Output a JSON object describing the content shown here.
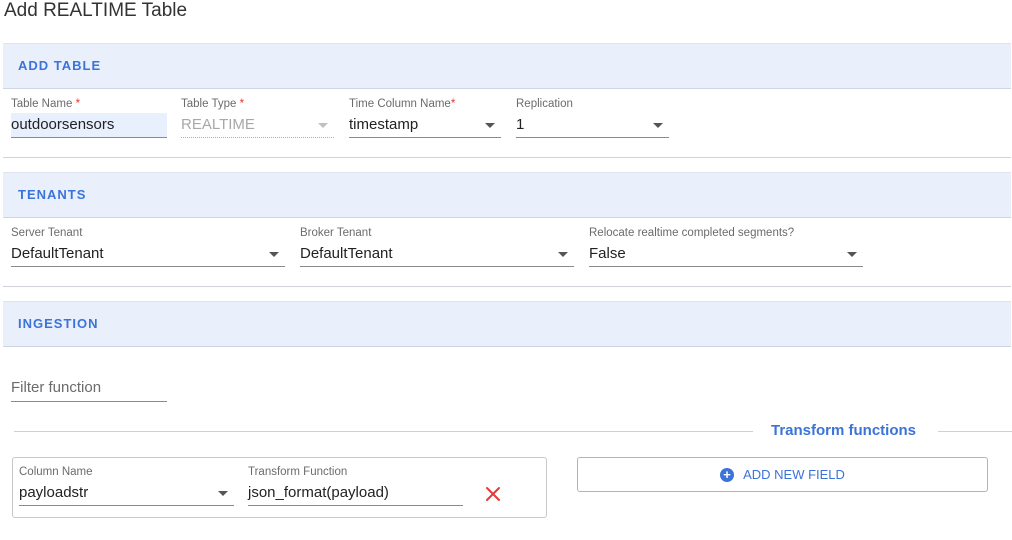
{
  "page": {
    "title": "Add REALTIME Table"
  },
  "sections": {
    "add_table": {
      "heading": "ADD TABLE",
      "table_name": {
        "label": "Table Name",
        "required": "*",
        "value": "outdoorsensors"
      },
      "table_type": {
        "label": "Table Type",
        "required": "*",
        "value": "REALTIME"
      },
      "time_column": {
        "label": "Time Column Name",
        "required": "*",
        "value": "timestamp"
      },
      "replication": {
        "label": "Replication",
        "value": "1"
      }
    },
    "tenants": {
      "heading": "TENANTS",
      "server_tenant": {
        "label": "Server Tenant",
        "value": "DefaultTenant"
      },
      "broker_tenant": {
        "label": "Broker Tenant",
        "value": "DefaultTenant"
      },
      "relocate": {
        "label": "Relocate realtime completed segments?",
        "value": "False"
      }
    },
    "ingestion": {
      "heading": "INGESTION",
      "filter_function": {
        "placeholder": "Filter function"
      },
      "transform_title": "Transform functions",
      "column_name": {
        "label": "Column Name",
        "value": "payloadstr"
      },
      "transform_function": {
        "label": "Transform Function",
        "value": "json_format(payload)"
      },
      "add_field_label": "ADD NEW FIELD"
    }
  },
  "colors": {
    "accent": "#3b73d9",
    "section_bg": "#eaf0fb",
    "delete": "#e53935"
  },
  "icons": {
    "add": "plus-circle-icon",
    "delete": "close-icon",
    "dropdown": "chevron-down-icon"
  }
}
